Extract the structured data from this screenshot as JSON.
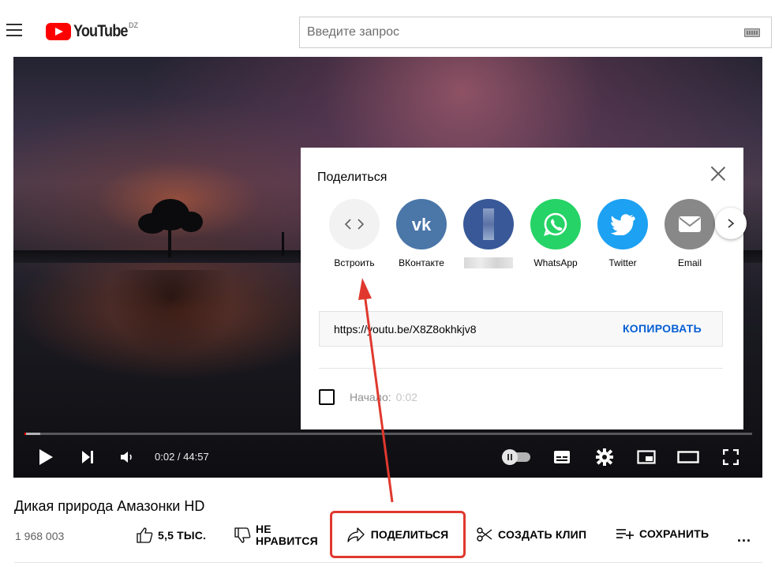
{
  "header": {
    "logo_text": "YouTube",
    "region": "DZ",
    "search_placeholder": "Введите запрос"
  },
  "share_dialog": {
    "title": "Поделиться",
    "targets": [
      {
        "label": "Встроить",
        "icon": "embed-icon",
        "color": "#f2f2f2"
      },
      {
        "label": "ВКонтакте",
        "icon": "vk-icon",
        "color": "#4a76a8"
      },
      {
        "label": "",
        "icon": "facebook-icon",
        "color": "#385898"
      },
      {
        "label": "WhatsApp",
        "icon": "whatsapp-icon",
        "color": "#25d366"
      },
      {
        "label": "Twitter",
        "icon": "twitter-icon",
        "color": "#1da1f2"
      },
      {
        "label": "Email",
        "icon": "email-icon",
        "color": "#888888"
      }
    ],
    "url": "https://youtu.be/X8Z8okhkjv8",
    "copy_label": "КОПИРОВАТЬ",
    "start_label": "Начало:",
    "start_time": "0:02"
  },
  "player": {
    "time": "0:02 / 44:57",
    "progress_fraction": 0.0007
  },
  "video": {
    "title": "Дикая природа Амазонки HD",
    "views": "1 968 003",
    "like_count": "5,5 ТЫС.",
    "dislike_label_1": "НЕ",
    "dislike_label_2": "НРАВИТСЯ",
    "share_label": "ПОДЕЛИТЬСЯ",
    "clip_label": "СОЗДАТЬ КЛИП",
    "save_label": "СОХРАНИТЬ",
    "more_label": "..."
  },
  "colors": {
    "brand_red": "#ff0000",
    "link_blue": "#065fd4",
    "annotation_red": "#e0382e"
  }
}
